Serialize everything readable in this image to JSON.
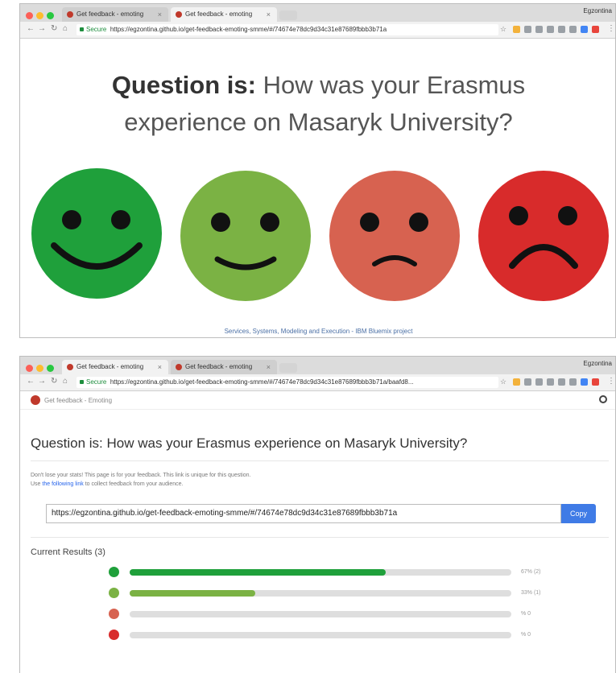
{
  "colors": {
    "very_happy": "#1fa03b",
    "happy": "#7bb244",
    "sad": "#d76250",
    "very_sad": "#d82b2b",
    "link": "#2563eb",
    "copy_button": "#3f7be6"
  },
  "window1": {
    "tabs": [
      {
        "label": "Get feedback - emoting"
      },
      {
        "label": "Get feedback - emoting"
      }
    ],
    "profile": "Egzontina",
    "url_secure": "Secure",
    "url": "https://egzontina.github.io/get-feedback-emoting-smme/#/74674e78dc9d34c31e87689fbbb3b71a",
    "question_prefix": "Question is:",
    "question_line1": "How was your Erasmus",
    "question_line2": "experience on Masaryk University?",
    "faces": [
      "very-happy-face-icon",
      "happy-face-icon",
      "sad-face-icon",
      "very-sad-face-icon"
    ],
    "footer": "Services, Systems, Modeling and Execution - IBM Bluemix project"
  },
  "window2": {
    "tabs": [
      {
        "label": "Get feedback - emoting"
      },
      {
        "label": "Get feedback - emoting"
      }
    ],
    "profile": "Egzontina",
    "url_secure": "Secure",
    "url": "https://egzontina.github.io/get-feedback-emoting-smme/#/74674e78dc9d34c31e87689fbbb3b71a/baafd8...",
    "app_name": "Get feedback - Emoting",
    "question": "Question is: How was your Erasmus experience on Masaryk University?",
    "info_line1": "Don't lose your stats! This page is for your feedback. This link is unique for this question.",
    "info_line2_prefix": "Use ",
    "info_line2_link": "the following link",
    "info_line2_suffix": " to collect feedback from your audience.",
    "share_link": "https://egzontina.github.io/get-feedback-emoting-smme/#/74674e78dc9d34c31e87689fbbb3b71a",
    "copy_label": "Copy",
    "results_title": "Current Results (3)",
    "results": [
      {
        "face": "very-happy-face-icon",
        "percent": 67,
        "label": "67% (2)"
      },
      {
        "face": "happy-face-icon",
        "percent": 33,
        "label": "33% (1)"
      },
      {
        "face": "sad-face-icon",
        "percent": 0,
        "label": "% 0"
      },
      {
        "face": "very-sad-face-icon",
        "percent": 0,
        "label": "% 0"
      }
    ]
  }
}
